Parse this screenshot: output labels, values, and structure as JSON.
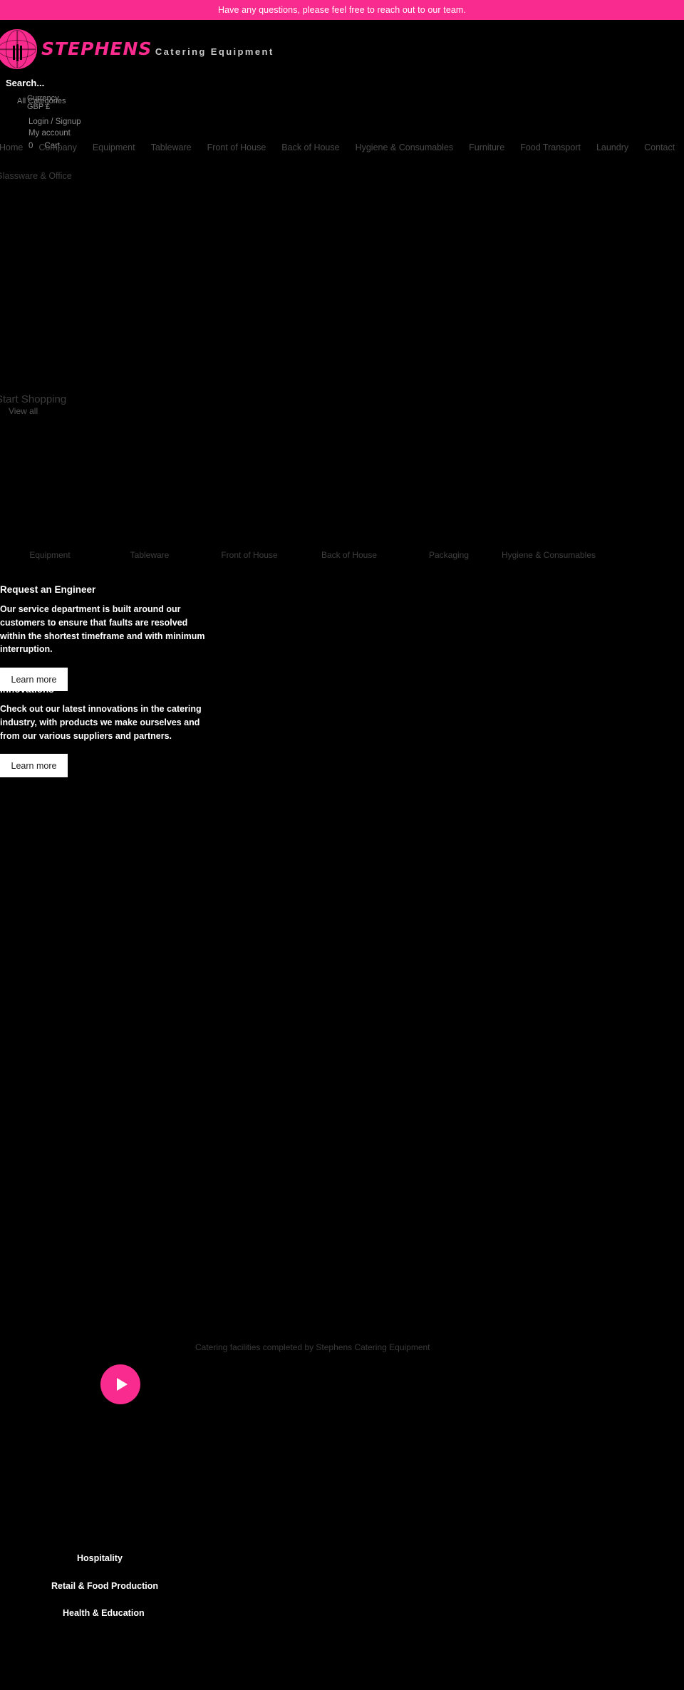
{
  "announcement": {
    "text": "Have any questions, please feel free to reach out to our team."
  },
  "brand": {
    "name": "STEPHENS",
    "tagline": "Catering Equipment",
    "accent_color": "#f92b8e",
    "globe_icon": "globe-icon",
    "background_color": "#000000"
  },
  "header": {
    "search_placeholder": "Search...",
    "all_categories_label": "All Categories",
    "currency_label": "Currency",
    "currency_value": "GBP £",
    "login_label": "Login / Signup",
    "account_label": "My account",
    "cart_label": "Cart",
    "cart_count": "0"
  },
  "nav": {
    "items": [
      {
        "label": "Home"
      },
      {
        "label": "Company"
      },
      {
        "label": "Equipment"
      },
      {
        "label": "Tableware"
      },
      {
        "label": "Front of House"
      },
      {
        "label": "Back of House"
      },
      {
        "label": "Hygiene & Consumables"
      },
      {
        "label": "Furniture"
      },
      {
        "label": "Food Transport"
      },
      {
        "label": "Laundry"
      },
      {
        "label": "Contact"
      }
    ],
    "secondary_label": "Glassware & Office"
  },
  "shop": {
    "title": "Start Shopping",
    "view_all_label": "View all"
  },
  "categories": {
    "items": [
      {
        "label": "Equipment"
      },
      {
        "label": "Tableware"
      },
      {
        "label": "Front of House"
      },
      {
        "label": "Back of House"
      },
      {
        "label": "Packaging"
      },
      {
        "label": "Hygiene & Consumables"
      }
    ]
  },
  "services": [
    {
      "title": "Request an Engineer",
      "body": "Our service department is built around our customers to ensure that faults are resolved within the shortest timeframe and with minimum interruption.",
      "button_label": "Learn more"
    },
    {
      "title": "Innovations",
      "body": "Check out our latest innovations in the catering industry, with products we make ourselves and from our various suppliers and partners.",
      "button_label": "Learn more"
    }
  ],
  "video": {
    "caption": "Catering facilities completed by Stephens Catering Equipment",
    "play_icon": "play-icon"
  },
  "sectors": {
    "items": [
      {
        "label": "Hospitality"
      },
      {
        "label": "Retail & Food Production"
      },
      {
        "label": "Health & Education"
      }
    ]
  }
}
